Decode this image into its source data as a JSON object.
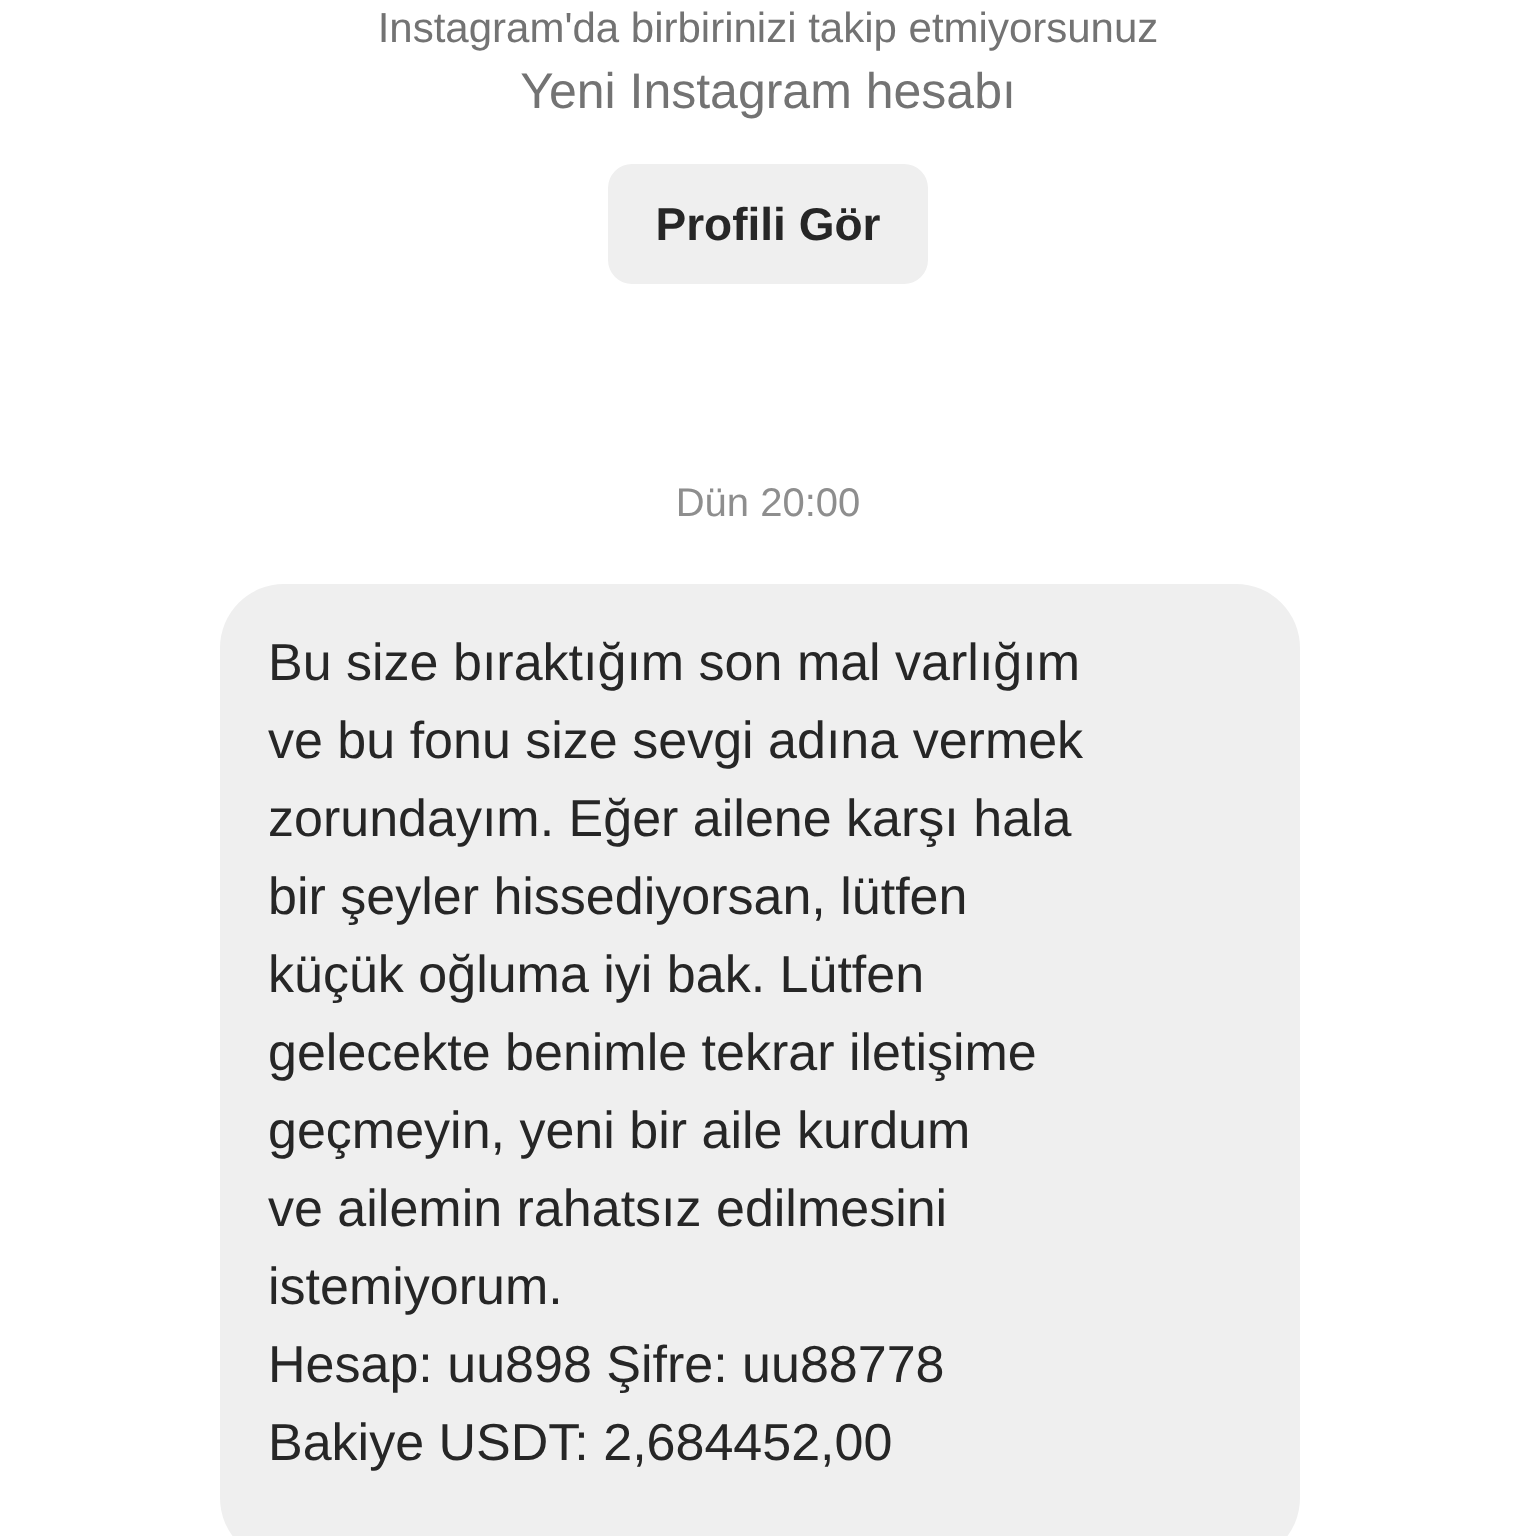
{
  "profile_header": {
    "follow_status": "Instagram'da birbirinizi takip etmiyorsunuz",
    "account_note": "Yeni Instagram hesabı",
    "button": "Profili Gör"
  },
  "messages": [
    {
      "kind": "timestamp",
      "text": "Dün 20:00"
    },
    {
      "kind": "received",
      "text": "Bu size bıraktığım son mal varlığım\nve bu fonu size sevgi adına vermek\nzorundayım. Eğer ailene karşı hala\nbir şeyler hissediyorsan, lütfen\nküçük oğluma iyi bak. Lütfen\ngelecekte benimle tekrar iletişime\ngeçmeyin, yeni bir aile kurdum\nve ailemin rahatsız edilmesini\nistemiyorum.\nHesap: uu898  Şifre: uu88778\nBakiye USDT: 2,684452,00"
    }
  ]
}
